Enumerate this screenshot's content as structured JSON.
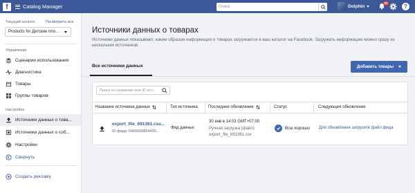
{
  "topbar": {
    "logo": "f",
    "app_title": "Catalog Manager",
    "search_placeholder": "Поиск",
    "user_name": "Dolphin",
    "notification_count": "86"
  },
  "sidebar": {
    "catalog_label": "Текущий каталог",
    "catalog_link": "Посмотреть все",
    "catalog_value": "Products for Детские пло...",
    "section_manage": "Управление",
    "manage_items": [
      {
        "label": "Сценарии использования",
        "icon": "layers-icon"
      },
      {
        "label": "Диагностика",
        "icon": "pulse-icon"
      },
      {
        "label": "Товары",
        "icon": "box-icon"
      },
      {
        "label": "Группы товаров",
        "icon": "boxes-icon"
      }
    ],
    "section_settings": "Настройка",
    "settings_items": [
      {
        "label": "Источники данных о това...",
        "icon": "upload-icon"
      },
      {
        "label": "Источники данных о соб...",
        "icon": "events-icon"
      },
      {
        "label": "Настройки",
        "icon": "gear-icon"
      }
    ],
    "collapse": "Свернуть",
    "create_ad": "Создать рекламу"
  },
  "main": {
    "title": "Источники данных о товарах",
    "description": "Источники данных показывают, каким образом информация о товарах загружается в ваш каталог на Facebook. Загружать информацию можно сразу из нескольких источников.",
    "tab": "Все источники данных",
    "add_button": "Добавить товары",
    "table_search_placeholder": "Поиск по названию или ID ист...",
    "columns": [
      "Название источника данных",
      "Тип источника",
      "Последнее обновление",
      "Статус",
      "Следующее обновление"
    ],
    "row": {
      "name": "export_file_691361.csv...",
      "id": "ID фида: 6465669894400...",
      "type": "Фид данных",
      "updated": "30 янв в 14:03 GMT+07:00",
      "method": "Ручная загрузка (файл)",
      "file": "export_file_691361.csv",
      "status": "Все хорошо",
      "next_update": "Для обновления загрузите файл фида"
    }
  },
  "colors": {
    "topbar": "#3b5998",
    "primary_button": "#4267b2",
    "link": "#385898"
  }
}
